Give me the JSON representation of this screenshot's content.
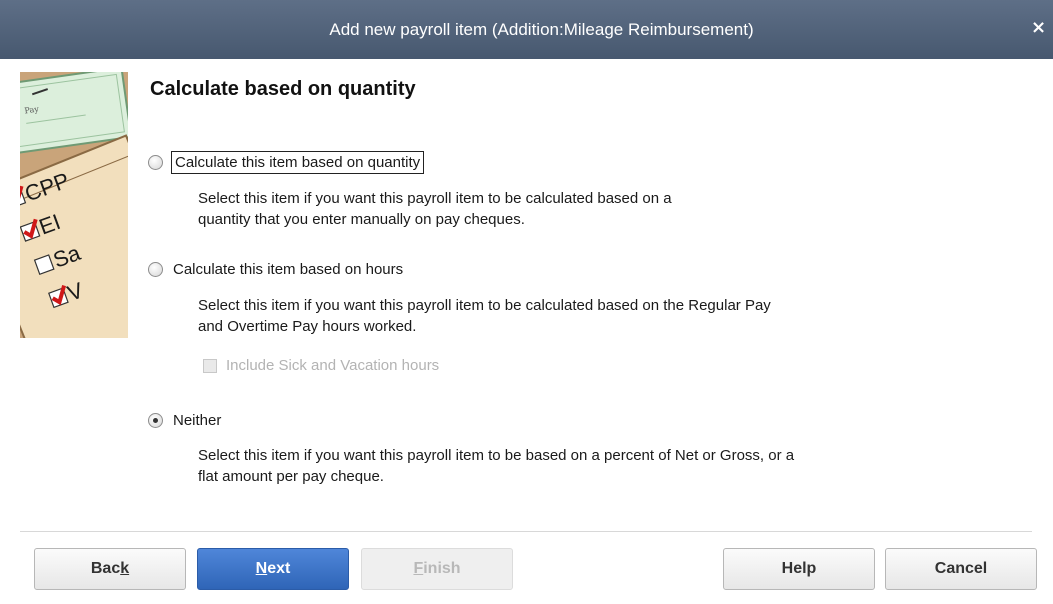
{
  "window": {
    "title": "Add new payroll item (Addition:Mileage Reimbursement)",
    "close_symbol": "×"
  },
  "graphic": {
    "checklist": [
      "CPP",
      "EI",
      "Sa",
      "V"
    ]
  },
  "page": {
    "heading": "Calculate based on quantity"
  },
  "options": [
    {
      "label": "Calculate this item based on quantity",
      "checked": false,
      "description_lines": [
        "Select this item if you want this payroll item to be calculated based on a",
        "quantity that you enter manually on pay cheques."
      ]
    },
    {
      "label": "Calculate this item based on hours",
      "checked": false,
      "description_lines": [
        "Select this item if you want this payroll item to be calculated based on the Regular Pay",
        "and Overtime Pay hours worked."
      ],
      "sub_option": {
        "label": "Include Sick and Vacation hours",
        "checked": false,
        "disabled": true
      }
    },
    {
      "label": "Neither",
      "checked": true,
      "description_lines": [
        "Select this item if you want this payroll item to be based on a percent of Net or Gross, or a",
        "flat amount per pay cheque."
      ]
    }
  ],
  "buttons": {
    "back": {
      "before": "Bac",
      "accel": "k",
      "after": ""
    },
    "next": {
      "before": "",
      "accel": "N",
      "after": "ext"
    },
    "finish": {
      "before": "",
      "accel": "F",
      "after": "inish"
    },
    "help": "Help",
    "cancel": "Cancel"
  },
  "colors": {
    "titlebar": "#52637b",
    "primary_button": "#3a72c6",
    "check_red": "#d01818"
  }
}
